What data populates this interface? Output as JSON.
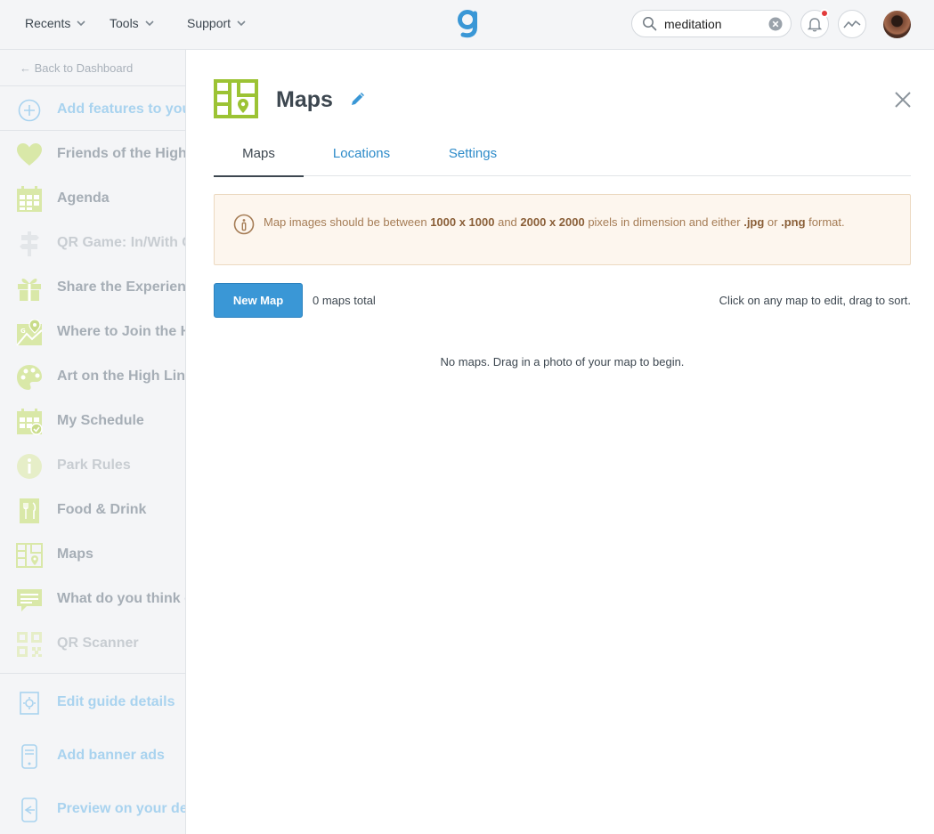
{
  "topbar": {
    "nav": [
      {
        "label": "Recents"
      },
      {
        "label": "Tools"
      },
      {
        "label": "Support"
      }
    ],
    "search_value": "meditation",
    "colors": {
      "brand": "#3a97d6",
      "notification": "#e23b3b"
    }
  },
  "sidebar": {
    "back_label": "← Back to Dashboard",
    "add_features": "Add features to your guide",
    "items": [
      {
        "label": "Friends of the High Line",
        "icon": "heart-icon"
      },
      {
        "label": "Agenda",
        "icon": "calendar-icon"
      },
      {
        "label": "QR Game: In/With Color",
        "icon": "signpost-icon"
      },
      {
        "label": "Share the Experience",
        "icon": "gift-icon"
      },
      {
        "label": "Where to Join the High Line",
        "icon": "map-pin-icon"
      },
      {
        "label": "Art on the High Line",
        "icon": "palette-icon"
      },
      {
        "label": "My Schedule",
        "icon": "schedule-icon"
      },
      {
        "label": "Park Rules",
        "icon": "info-icon"
      },
      {
        "label": "Food & Drink",
        "icon": "food-icon"
      },
      {
        "label": "Maps",
        "icon": "maps-icon"
      },
      {
        "label": "What do you think of the High Line?",
        "icon": "comment-icon"
      },
      {
        "label": "QR Scanner",
        "icon": "qr-icon"
      }
    ],
    "bottom": [
      {
        "label": "Edit guide details",
        "icon": "settings-icon"
      },
      {
        "label": "Add banner ads",
        "icon": "phone-icon"
      },
      {
        "label": "Preview on your device",
        "icon": "preview-icon"
      }
    ],
    "colors": {
      "icon_green": "#d9e8a8",
      "blue_link": "#a9d3ef"
    }
  },
  "main": {
    "title": "Maps",
    "tabs": [
      {
        "label": "Maps"
      },
      {
        "label": "Locations"
      },
      {
        "label": "Settings"
      }
    ],
    "notice": {
      "p1": "Map images should be between ",
      "b1": "1000 x 1000",
      "p2": " and ",
      "b2": "2000 x 2000",
      "p3": " pixels in dimension and either ",
      "b3": ".jpg",
      "p4": " or ",
      "b4": ".png",
      "p5": " format."
    },
    "new_map_label": "New Map",
    "count_label": "0 maps total",
    "hint": "Click on any map to edit, drag to sort.",
    "empty_message": "No maps. Drag in a photo of your map to begin."
  }
}
